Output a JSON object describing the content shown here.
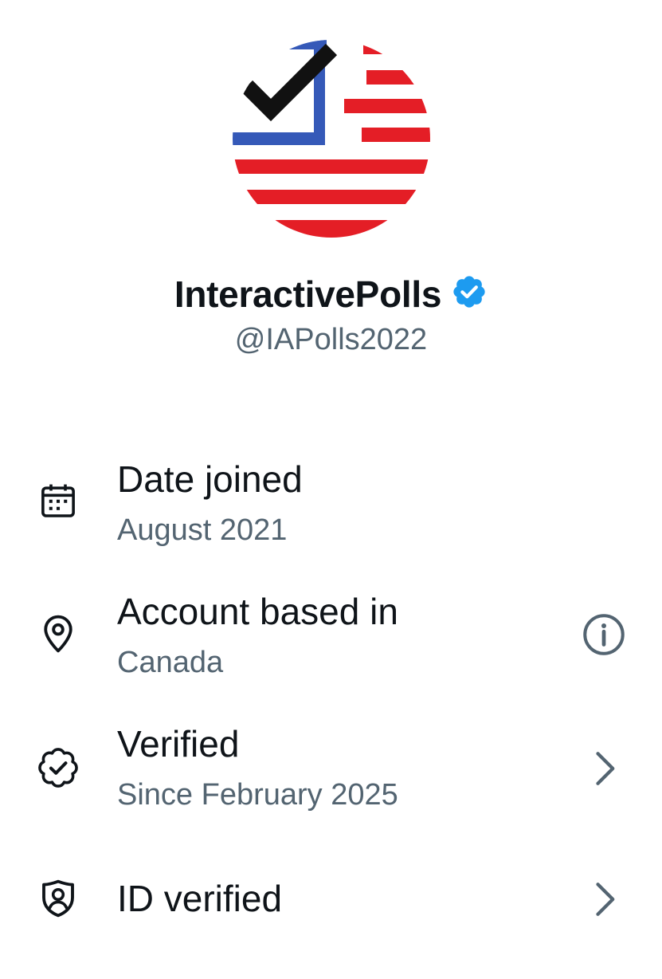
{
  "profile": {
    "display_name": "InteractivePolls",
    "handle": "@IAPolls2022",
    "verified": true,
    "badge_color": "#1d9bf0",
    "avatar_colors": {
      "red": "#e41e26",
      "blue": "#3559b8",
      "check": "#111111"
    }
  },
  "details": [
    {
      "icon": "calendar-icon",
      "title": "Date joined",
      "subtitle": "August 2021",
      "trailing": "none"
    },
    {
      "icon": "location-pin-icon",
      "title": "Account based in",
      "subtitle": "Canada",
      "trailing": "info-icon"
    },
    {
      "icon": "verified-check-icon",
      "title": "Verified",
      "subtitle": "Since February 2025",
      "trailing": "chevron-right-icon"
    },
    {
      "icon": "id-shield-icon",
      "title": "ID verified",
      "subtitle": "",
      "trailing": "chevron-right-icon"
    }
  ],
  "colors": {
    "primary_text": "#0f1419",
    "secondary_text": "#536471"
  }
}
